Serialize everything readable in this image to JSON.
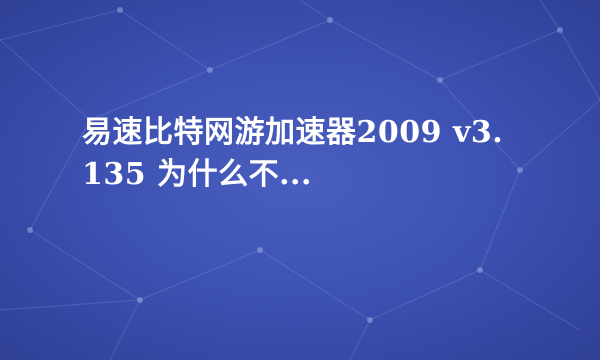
{
  "title": "易速比特网游加速器2009 v3.135 为什么不...",
  "colors": {
    "background": "#3e52b4",
    "network_lines": "#8ea0e8",
    "text": "#ffffff"
  },
  "decoration": "network-mesh-background"
}
